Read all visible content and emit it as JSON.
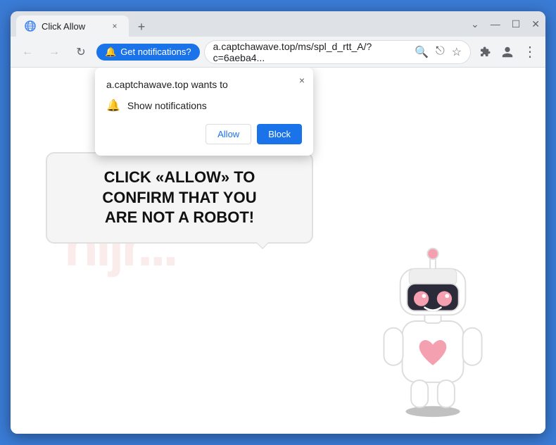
{
  "window": {
    "title": "Click Allow",
    "tab_close": "×",
    "new_tab": "+",
    "controls": {
      "minimize": "—",
      "maximize": "☐",
      "close": "✕",
      "chevron": "⌄"
    }
  },
  "toolbar": {
    "back_label": "←",
    "forward_label": "→",
    "refresh_label": "↻",
    "notification_btn": "Get notifications?",
    "address": "a.captchawave.top/ms/spl_d_rtt_A/?c=6aeba4...",
    "search_icon": "🔍",
    "share_icon": "⎋",
    "bookmark_icon": "☆",
    "extensions_icon": "⧉",
    "profile_icon": "👤",
    "menu_icon": "⋮"
  },
  "popup": {
    "title": "a.captchawave.top wants to",
    "close": "×",
    "notification_label": "Show notifications",
    "allow_btn": "Allow",
    "block_btn": "Block"
  },
  "page": {
    "cta_line1": "CLICK «ALLOW» TO CONFIRM THAT YOU",
    "cta_line2": "ARE NOT A ROBOT!",
    "watermark": "hijr..."
  }
}
